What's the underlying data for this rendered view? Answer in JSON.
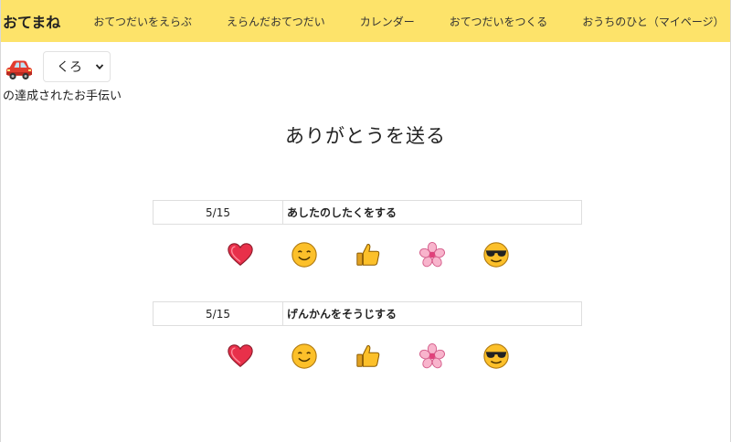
{
  "navbar": {
    "brand": "おてまね",
    "items": [
      {
        "label": "おてつだいをえらぶ"
      },
      {
        "label": "えらんだおてつだい"
      },
      {
        "label": "カレンダー"
      },
      {
        "label": "おてつだいをつくる"
      },
      {
        "label": "おうちのひと（マイページ）"
      }
    ],
    "color": "#fde36a"
  },
  "child": {
    "icon": "car-icon",
    "selected": "くろ"
  },
  "subtitle": "の達成されたお手伝い",
  "heading": "ありがとうを送る",
  "chores": [
    {
      "date": "5/15",
      "title": "あしたのしたくをする"
    },
    {
      "date": "5/15",
      "title": "げんかんをそうじする"
    }
  ],
  "reactions": [
    "heart-icon",
    "smile-icon",
    "thumbs-up-icon",
    "cherry-blossom-icon",
    "sunglasses-icon"
  ]
}
